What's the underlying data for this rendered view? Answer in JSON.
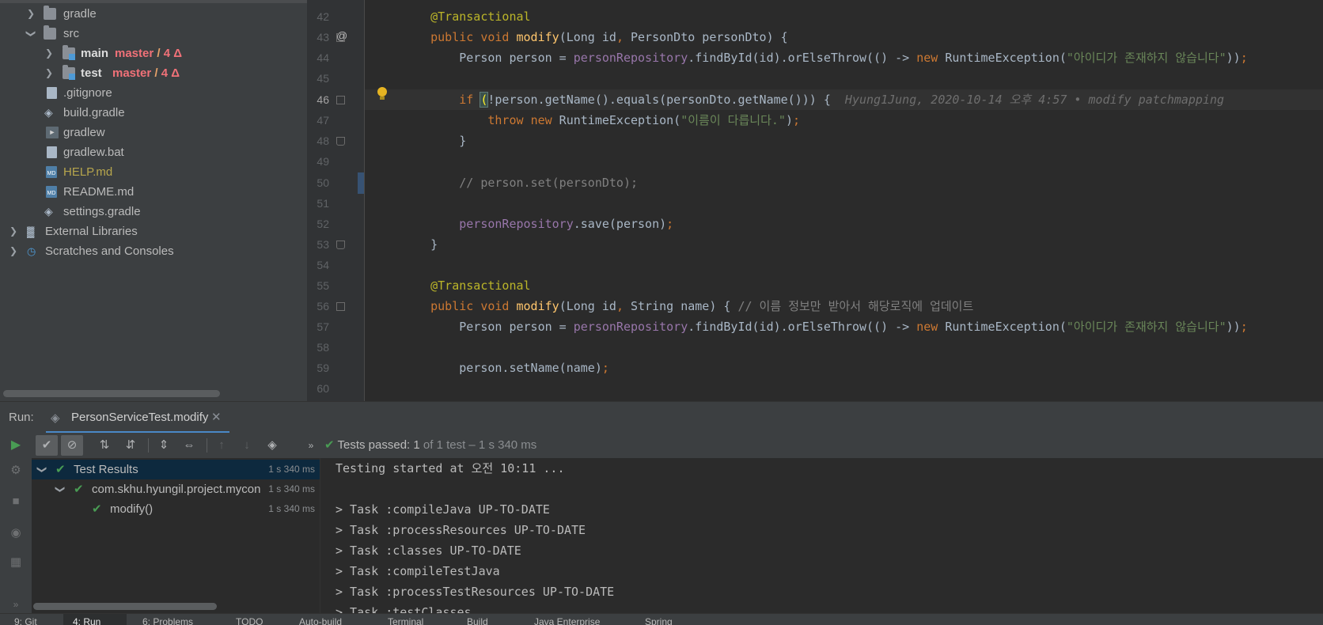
{
  "project_tree": {
    "items": [
      {
        "label": "gradle",
        "kind": "folder",
        "indent": 1,
        "expanded": false
      },
      {
        "label": "src",
        "kind": "folder",
        "indent": 1,
        "expanded": true
      },
      {
        "label": "main",
        "kind": "module",
        "indent": 2,
        "expanded": false,
        "vcs_branch": "master",
        "vcs_sep": "/",
        "vcs_changes": "4 Δ"
      },
      {
        "label": "test",
        "kind": "module",
        "indent": 2,
        "expanded": false,
        "vcs_branch": "master",
        "vcs_sep": "/",
        "vcs_changes": "4 Δ"
      },
      {
        "label": ".gitignore",
        "kind": "ignore-file"
      },
      {
        "label": "build.gradle",
        "kind": "gradle-file"
      },
      {
        "label": "gradlew",
        "kind": "script-file"
      },
      {
        "label": "gradlew.bat",
        "kind": "text-file"
      },
      {
        "label": "HELP.md",
        "kind": "md-file",
        "highlight": "#b7a64d"
      },
      {
        "label": "README.md",
        "kind": "md-file"
      },
      {
        "label": "settings.gradle",
        "kind": "gradle-file"
      },
      {
        "label": "External Libraries",
        "kind": "library"
      },
      {
        "label": "Scratches and Consoles",
        "kind": "scratches"
      }
    ]
  },
  "editor": {
    "lines": [
      {
        "num": "42",
        "text": "@Transactional"
      },
      {
        "num": "43",
        "text": "public void modify(Long id, PersonDto personDto) {",
        "marker": "@"
      },
      {
        "num": "44",
        "text": "Person person = personRepository.findById(id).orElseThrow(() -> new RuntimeException(\"아이디가 존재하지 않습니다\"));"
      },
      {
        "num": "45",
        "text": ""
      },
      {
        "num": "46",
        "text": "if (!person.getName().equals(personDto.getName())) {",
        "hint": "Hyung1Jung, 2020-10-14 오후 4:57 • modify patchmapping"
      },
      {
        "num": "47",
        "text": "throw new RuntimeException(\"이름이 다릅니다.\");"
      },
      {
        "num": "48",
        "text": "}"
      },
      {
        "num": "49",
        "text": ""
      },
      {
        "num": "50",
        "text": "// person.set(personDto);"
      },
      {
        "num": "51",
        "text": ""
      },
      {
        "num": "52",
        "text": "personRepository.save(person);"
      },
      {
        "num": "53",
        "text": "}"
      },
      {
        "num": "54",
        "text": ""
      },
      {
        "num": "55",
        "text": "@Transactional"
      },
      {
        "num": "56",
        "text": "public void modify(Long id, String name) {",
        "comment": "// 이름 정보만 받아서 해당로직에 업데이트"
      },
      {
        "num": "57",
        "text": "Person person = personRepository.findById(id).orElseThrow(() -> new RuntimeException(\"아이디가 존재하지 않습니다\"));"
      },
      {
        "num": "58",
        "text": ""
      },
      {
        "num": "59",
        "text": "person.setName(name);"
      },
      {
        "num": "60",
        "text": ""
      }
    ]
  },
  "run": {
    "label": "Run:",
    "tab_label": "PersonServiceTest.modify",
    "status_passed": "Tests passed:",
    "status_count": "1",
    "status_rest": "of 1 test – 1 s 340 ms",
    "test_tree": [
      {
        "label": "Test Results",
        "duration": "1 s 340 ms"
      },
      {
        "label": "com.skhu.hyungil.project.mycon",
        "duration": "1 s 340 ms"
      },
      {
        "label": "modify()",
        "duration": "1 s 340 ms"
      }
    ],
    "console": [
      "Testing started at 오전 10:11 ...",
      "",
      "> Task :compileJava UP-TO-DATE",
      "> Task :processResources UP-TO-DATE",
      "> Task :classes UP-TO-DATE",
      "> Task :compileTestJava",
      "> Task :processTestResources UP-TO-DATE",
      "> Task :testClasses"
    ]
  },
  "bottom_bar": {
    "items": [
      "9: Git",
      "4: Run",
      "6: Problems",
      "TODO",
      "Auto-build",
      "Terminal",
      "Build",
      "Java Enterprise",
      "Spring"
    ]
  },
  "colors": {
    "accent": "#4a88c7",
    "success": "#499c54",
    "keyword": "#cc7832",
    "annotation": "#bbb529",
    "string": "#6a8759",
    "field": "#9876aa",
    "method": "#ffc66d"
  }
}
